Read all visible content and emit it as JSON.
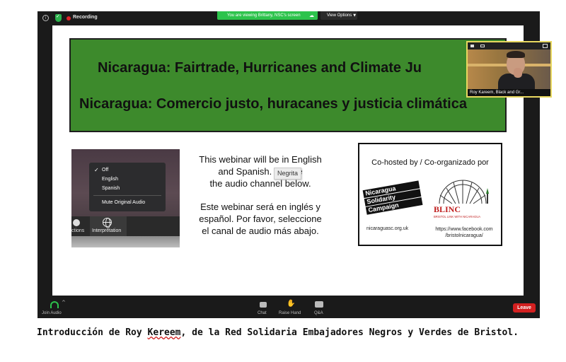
{
  "zoom": {
    "recording_label": "Recording",
    "viewing_banner": "You are viewing Brittany, NSC's screen",
    "view_options": "View Options",
    "video_name": "Roy Kareem, Black and Gr...",
    "toolbar": {
      "join_audio": "Join Audio",
      "chat": "Chat",
      "raise_hand": "Raise Hand",
      "qa": "Q&A",
      "leave": "Leave"
    }
  },
  "slide": {
    "title_en": "Nicaragua: Fairtrade, Hurricanes and Climate Ju",
    "title_es": "Nicaragua: Comercio justo, huracanes y justicia climática",
    "interpretation_menu": {
      "options": [
        "Off",
        "English",
        "Spanish"
      ],
      "selected": "Off",
      "mute_option": "Mute Original Audio",
      "partial_label": "ctions",
      "button_label": "Interpretation"
    },
    "text_en": "This webinar will be in English and Spanish. Please      the audio channel below.",
    "text_en_line1": "This webinar will be in English",
    "text_en_line2": "and Spanish. Please",
    "text_en_line3": "the audio channel below.",
    "text_es_line1": "Este webinar será en inglés y",
    "text_es_line2": "español. Por favor, seleccione",
    "text_es_line3": "el canal de audio más abajo.",
    "tooltip": "Negrita",
    "cohost": {
      "title": "Co-hosted by / Co-organizado por",
      "nsc_logo_lines": [
        "Nicaragua",
        "Solidarity",
        "Campaign"
      ],
      "nsc_url": "nicaraguasc.org.uk",
      "bristol_logo_text": "BLINC",
      "bristol_logo_subtext": "BRISTOL LINK WITH NICARAGUA",
      "bristol_url_line1": "https://www.facebook.com",
      "bristol_url_line2": "/bristolnicaragua/"
    }
  },
  "caption": {
    "part1": "Introducción de Roy ",
    "underlined": "Kereem",
    "part2": ", de la Red Solidaria Embajadores Negros y Verdes de Bristol."
  },
  "colors": {
    "banner_green": "#3d8a2c",
    "zoom_green": "#2dc34c",
    "leave_red": "#d32020",
    "recording_red": "#e0242a"
  }
}
